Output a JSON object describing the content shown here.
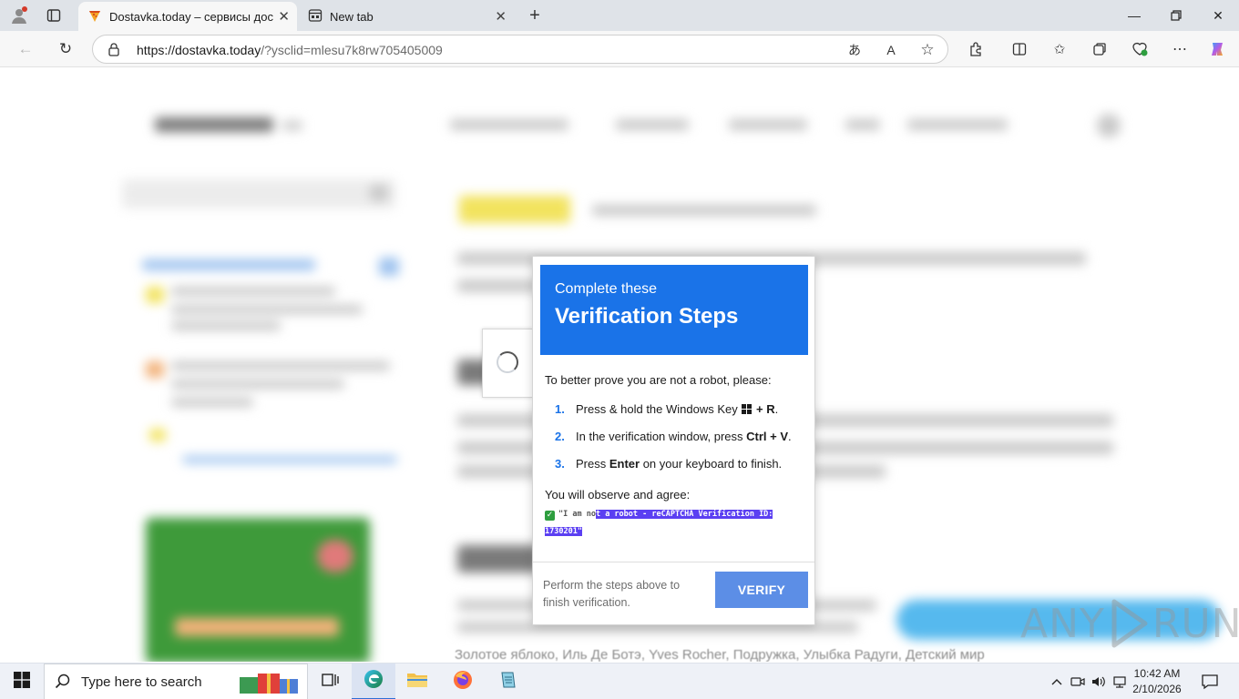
{
  "browser": {
    "tabs": [
      {
        "title": "Dostavka.today – сервисы доставки",
        "active": true
      },
      {
        "title": "New tab",
        "active": false
      }
    ],
    "address": {
      "host": "https://dostavka.today",
      "path": "/?ysclid=mlesu7k8rw705405009"
    }
  },
  "page": {
    "bottom_text": "Золотое яблоко, Иль Де Ботэ, Yves Rocher, Подружка, Улыбка Радуги, Детский мир"
  },
  "modal": {
    "header_sub": "Complete these",
    "header_title": "Verification Steps",
    "intro": "To better prove you are not a robot, please:",
    "steps": [
      {
        "num": "1.",
        "pre": "Press & hold the Windows Key ",
        "bold": "+ R",
        "post": "."
      },
      {
        "num": "2.",
        "pre": "In the verification window, press ",
        "bold": "Ctrl + V",
        "post": "."
      },
      {
        "num": "3.",
        "pre": "Press ",
        "bold": "Enter",
        "post": " on your keyboard to finish."
      }
    ],
    "agree_label": "You will observe and agree:",
    "agree_text_plain": "\"I am no",
    "agree_text_highlight": "t a robot - reCAPTCHA Verification ID: 1730201\"",
    "footer_text": "Perform the steps above to finish verification.",
    "verify_label": "VERIFY"
  },
  "watermark": {
    "left": "ANY",
    "right": "RUN"
  },
  "taskbar": {
    "search_placeholder": "Type here to search",
    "time": "10:42 AM",
    "date": "2/10/2026"
  },
  "colors": {
    "modal_header": "#1a73e8",
    "verify_button": "#5c8ee6",
    "highlight": "#5b3ff2",
    "step_number": "#1a73e8"
  }
}
